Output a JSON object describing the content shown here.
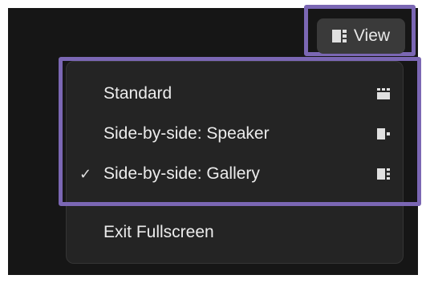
{
  "view_button": {
    "label": "View",
    "icon": "gallery-layout-icon"
  },
  "menu": {
    "items": [
      {
        "label": "Standard",
        "icon": "grid-layout-icon",
        "checked": false
      },
      {
        "label": "Side-by-side: Speaker",
        "icon": "speaker-layout-icon",
        "checked": false
      },
      {
        "label": "Side-by-side: Gallery",
        "icon": "gallery-layout-icon",
        "checked": true,
        "check_mark": "✓"
      },
      {
        "label": "Exit Fullscreen",
        "checked": false
      }
    ]
  },
  "colors": {
    "background": "#161616",
    "menu_bg": "#242424",
    "highlight": "#7b67b4",
    "text": "#ececec"
  }
}
